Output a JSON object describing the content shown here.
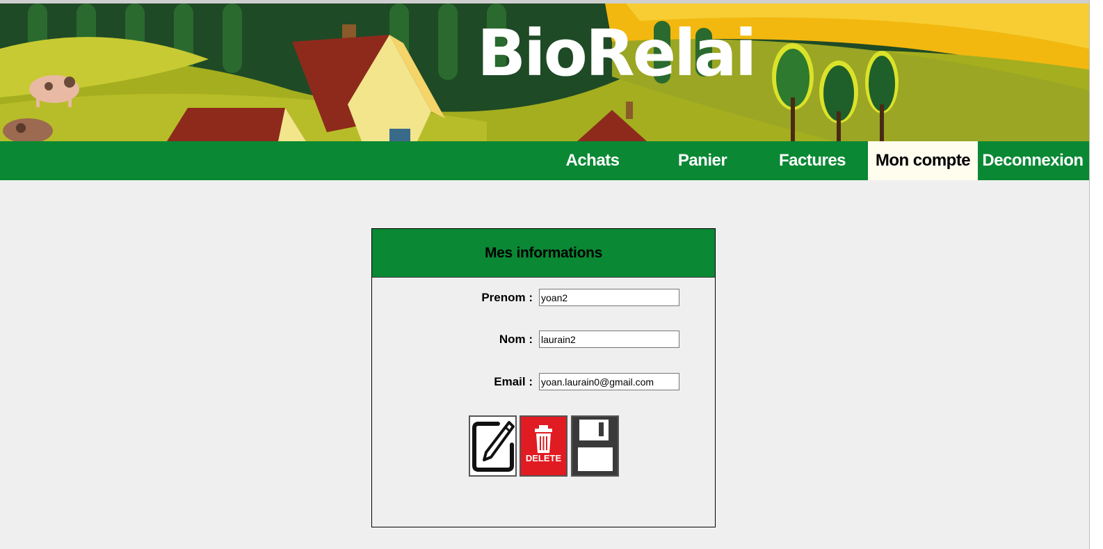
{
  "app": {
    "logo_text": "BioRelai"
  },
  "nav": {
    "items": [
      {
        "label": "Achats"
      },
      {
        "label": "Panier"
      },
      {
        "label": "Factures"
      },
      {
        "label": "Mon compte",
        "active": true
      },
      {
        "label": "Deconnexion"
      }
    ]
  },
  "card": {
    "title": "Mes informations",
    "fields": {
      "prenom": {
        "label": "Prenom :",
        "value": "yoan2"
      },
      "nom": {
        "label": "Nom :",
        "value": "laurain2"
      },
      "email": {
        "label": "Email :",
        "value": "yoan.laurain0@gmail.com"
      }
    },
    "buttons": {
      "edit_icon": "pencil-square-icon",
      "delete_label": "DELETE",
      "delete_icon": "trash-icon",
      "save_icon": "floppy-disk-icon"
    }
  },
  "colors": {
    "nav_green": "#0a8834",
    "active_tab": "#fffdee",
    "delete_red": "#e11b22",
    "page_bg": "#efefef"
  }
}
